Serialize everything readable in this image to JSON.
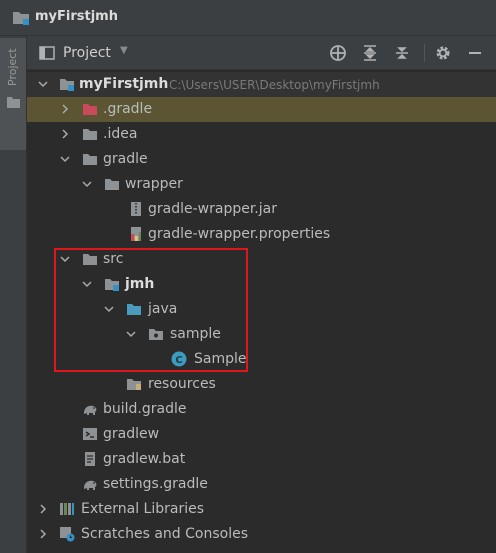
{
  "window": {
    "title": "myFirstjmh"
  },
  "stripe": {
    "project_tab": "Project"
  },
  "header": {
    "title": "Project"
  },
  "tree": {
    "root": {
      "label": "myFirstjmh",
      "path": "C:\\Users\\USER\\Desktop\\myFirstjmh"
    },
    "gradle_hidden": ".gradle",
    "idea": ".idea",
    "gradle": "gradle",
    "wrapper": "wrapper",
    "wrapper_jar": "gradle-wrapper.jar",
    "wrapper_props": "gradle-wrapper.properties",
    "src": "src",
    "jmh": "jmh",
    "java": "java",
    "sample_pkg": "sample",
    "sample_class": "Sample",
    "resources": "resources",
    "build_gradle": "build.gradle",
    "gradlew": "gradlew",
    "gradlew_bat": "gradlew.bat",
    "settings_gradle": "settings.gradle",
    "external_libraries": "External Libraries",
    "scratches": "Scratches and Consoles"
  },
  "colors": {
    "background": "#2b2b2b",
    "selection": "#5b5533",
    "highlight_box": "#e0161e",
    "folder": "#8f9295",
    "source_folder": "#4a9bbf",
    "excluded_folder": "#c94a5a"
  }
}
